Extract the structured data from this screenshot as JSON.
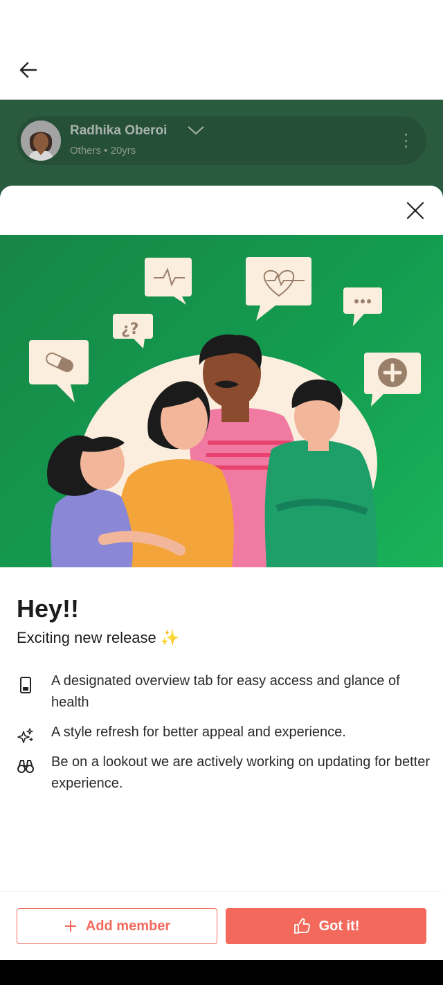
{
  "profile": {
    "name": "Radhika Oberoi",
    "subtitle": "Others • 20yrs"
  },
  "release": {
    "title": "Hey!!",
    "subtitle": "Exciting new release",
    "sparkle": "✨",
    "features": [
      {
        "icon": "phone-icon",
        "text": "A designated overview tab for easy access and glance of health"
      },
      {
        "icon": "sparkles-icon",
        "text": "A style refresh for better appeal and experience."
      },
      {
        "icon": "binoculars-icon",
        "text": "Be on a lookout we are actively working on updating for better experience."
      }
    ]
  },
  "hero": {
    "bubble_question_text": "¿?"
  },
  "footer": {
    "add_member_label": "Add member",
    "got_it_label": "Got it!"
  },
  "colors": {
    "accent": "#f36a5d",
    "hero_green": "#139c50",
    "profile_bg": "#2a5b3f"
  }
}
